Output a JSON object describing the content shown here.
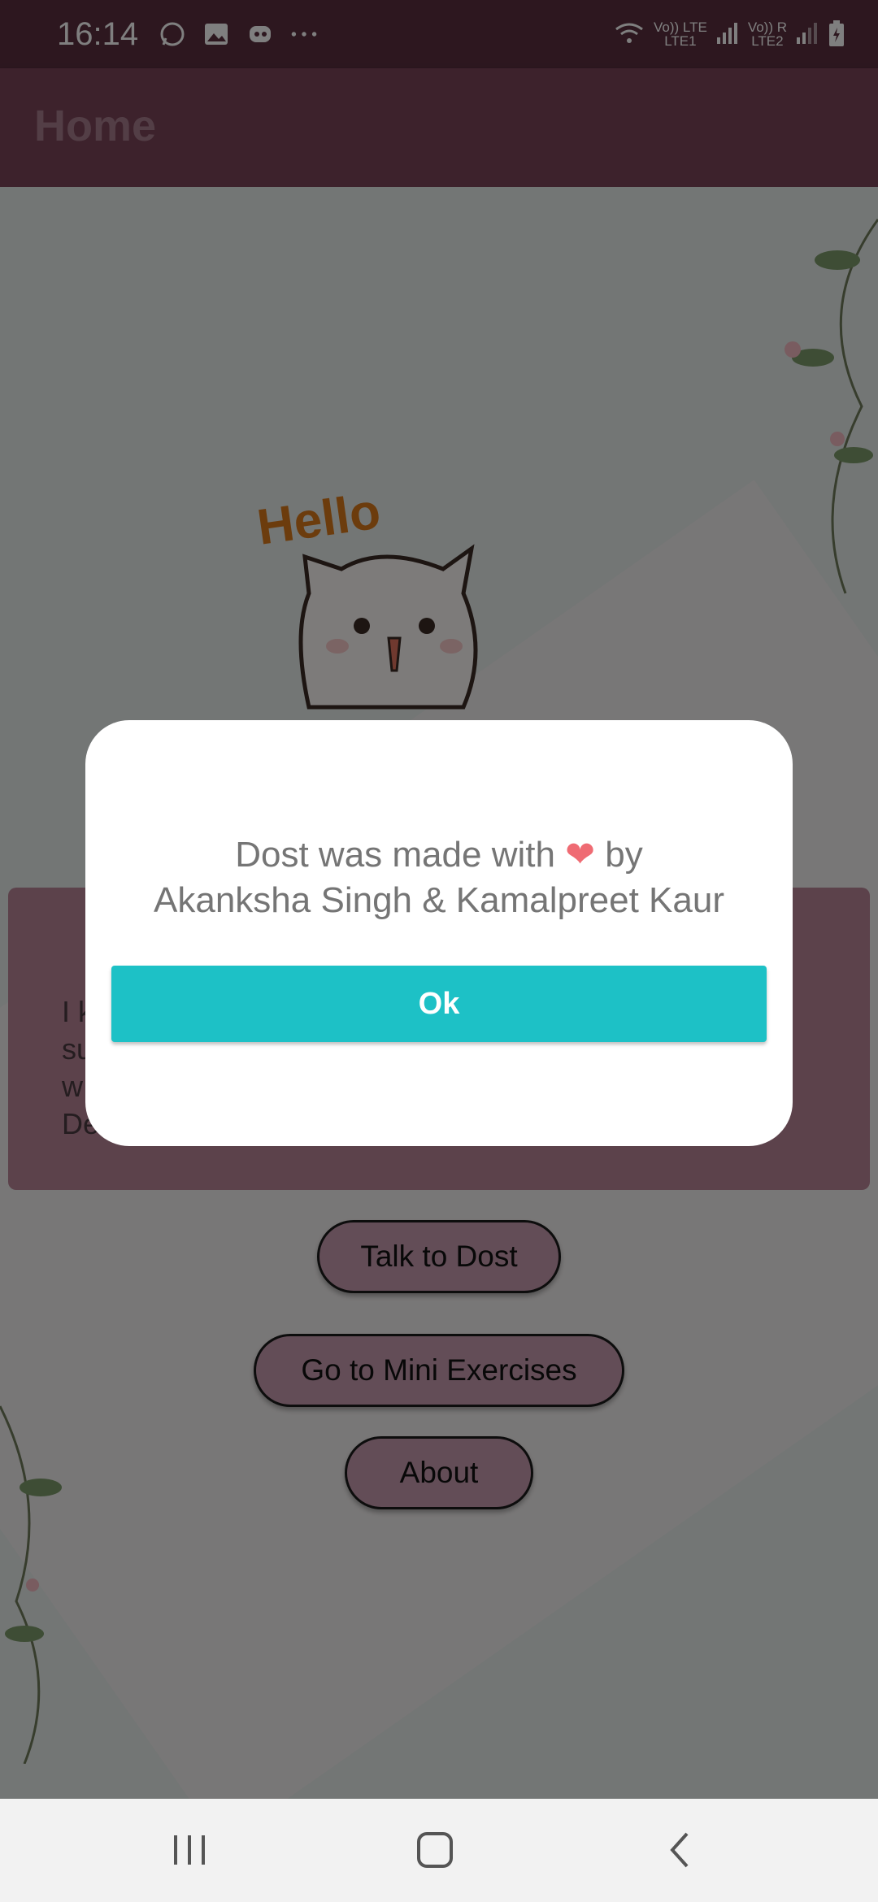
{
  "status_bar": {
    "time": "16:14",
    "icons": [
      "whatsapp-icon",
      "gallery-icon",
      "discord-icon",
      "more-icon"
    ],
    "net1_top": "Vo)) LTE",
    "net1_bottom": "LTE1",
    "net2_top": "Vo)) R",
    "net2_bottom": "LTE2"
  },
  "app_bar": {
    "title": "Home"
  },
  "mascot": {
    "greeting": "Hello"
  },
  "info_card": {
    "text": "I k\nsu\nw\nDe"
  },
  "buttons": {
    "talk": "Talk to Dost",
    "exercises": "Go to Mini Exercises",
    "about": "About"
  },
  "dialog": {
    "message_part1": "Dost was made with",
    "heart": "❤",
    "message_part2": "by",
    "message_line2": "Akanksha Singh & Kamalpreet Kaur",
    "ok_label": "Ok"
  },
  "colors": {
    "status_bar": "#5a2f3f",
    "app_bar": "#7a4459",
    "dialog_button": "#1dc1c6",
    "pill_button": "#c79bae"
  },
  "nav_bar": {
    "icons": [
      "recent-apps-icon",
      "home-icon",
      "back-icon"
    ]
  }
}
